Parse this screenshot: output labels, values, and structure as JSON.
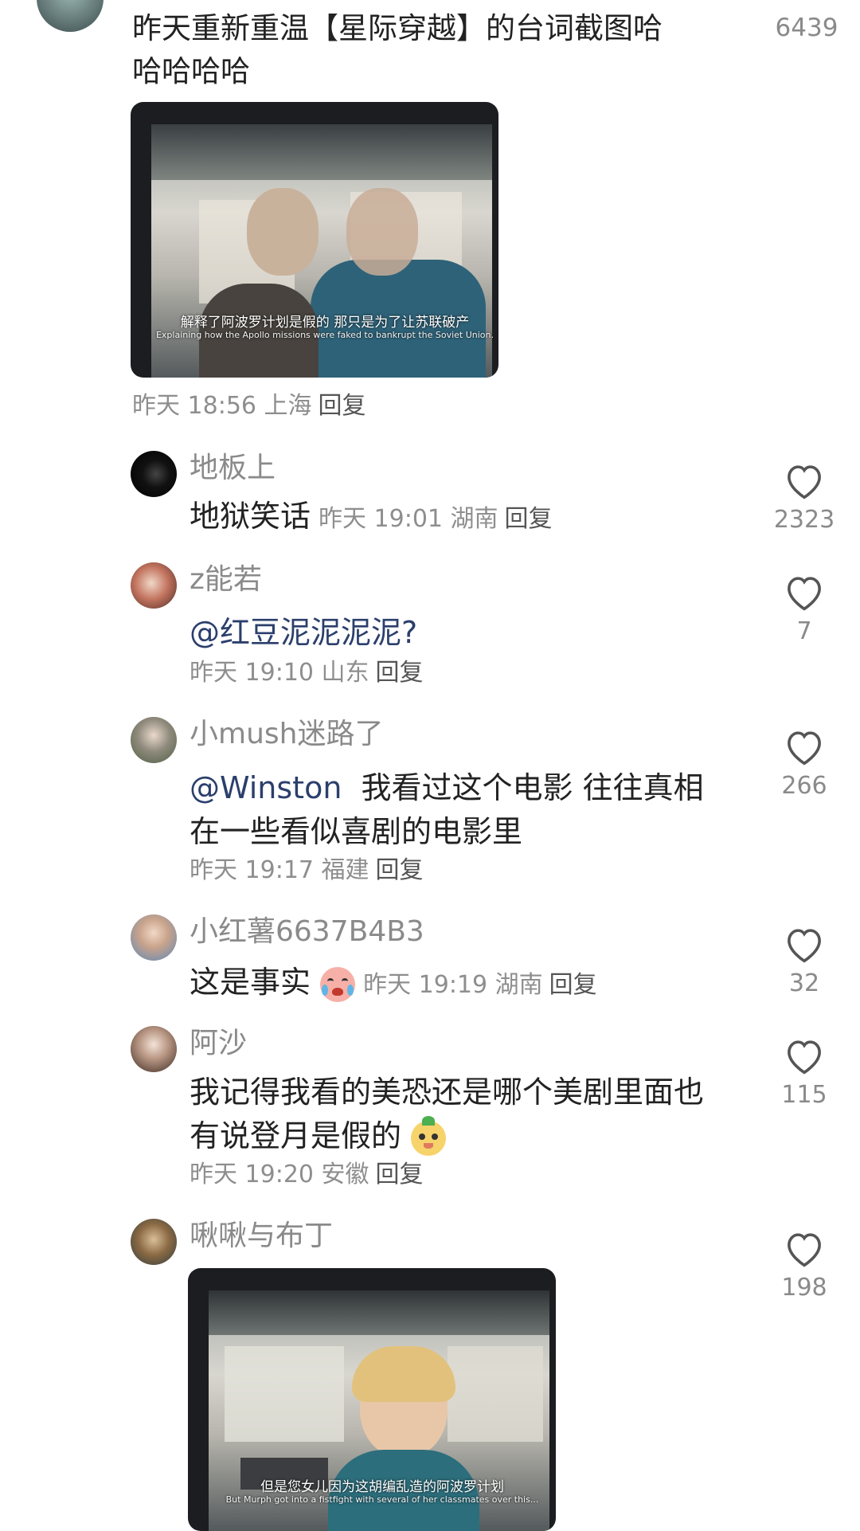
{
  "top_comment": {
    "text_line1": "昨天重新重温【星际穿越】的台词截图哈",
    "text_line2": "哈哈哈哈",
    "like_count": "6439",
    "image": {
      "subtitle_cn": "解释了阿波罗计划是假的 那只是为了让苏联破产",
      "subtitle_en": "Explaining how the Apollo missions were faked to bankrupt the Soviet Union."
    },
    "meta": "昨天 18:56 上海",
    "reply_label": "回复"
  },
  "replies": [
    {
      "username": "地板上",
      "text": "地狱笑话",
      "meta": "昨天 19:01 湖南",
      "reply_label": "回复",
      "like_count": "2323"
    },
    {
      "username": "z能若",
      "mention": "@红豆泥泥泥泥?",
      "meta": "昨天 19:10 山东",
      "reply_label": "回复",
      "like_count": "7"
    },
    {
      "username": "小mush迷路了",
      "mention": "@Winston",
      "text_line1": "我看过这个电影 往往真相",
      "text_line2": "在一些看似喜剧的电影里",
      "meta": "昨天 19:17 福建",
      "reply_label": "回复",
      "like_count": "266"
    },
    {
      "username": "小红薯6637B4B3",
      "text": "这是事实",
      "emoji": "crying-face-emoji",
      "meta": "昨天 19:19 湖南",
      "reply_label": "回复",
      "like_count": "32"
    },
    {
      "username": "阿沙",
      "text_line1": "我记得我看的美恐还是哪个美剧里面也",
      "text_line2": "有说登月是假的",
      "emoji": "cute-face-emoji",
      "meta": "昨天 19:20 安徽",
      "reply_label": "回复",
      "like_count": "115"
    },
    {
      "username": "啾啾与布丁",
      "image": {
        "subtitle_cn": "但是您女儿因为这胡编乱造的阿波罗计划",
        "subtitle_en": "But Murph got into a fistfight with several of her classmates over this..."
      },
      "like_count": "198"
    }
  ],
  "colors": {
    "text": "#222222",
    "secondary": "#8e8e8e",
    "mention": "#2b3f6c"
  }
}
